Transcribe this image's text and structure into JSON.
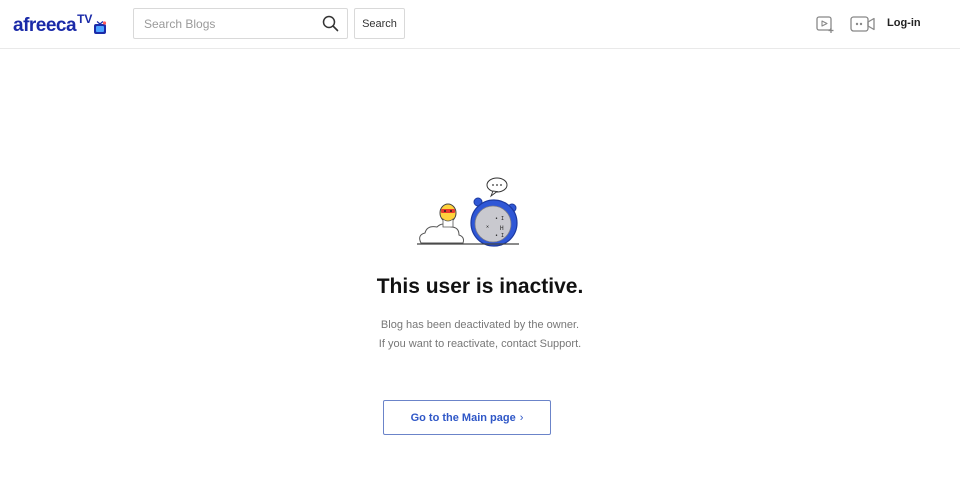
{
  "header": {
    "logo": {
      "text": "afreeca",
      "tv": "TV",
      "badge_icon": "tv-badge-icon",
      "color": "#1a2aa8"
    },
    "search": {
      "placeholder": "Search Blogs",
      "value": "",
      "button_label": "Search"
    },
    "icons": [
      "search-icon",
      "upload-icon",
      "live-broadcast-icon"
    ],
    "login_label": "Log-in"
  },
  "main": {
    "illustration_icon": "sleeping-character-illustration",
    "title": "This user is inactive.",
    "description_line1": "Blog has been deactivated by the owner.",
    "description_line2": "If you want to reactivate, contact Support.",
    "button_label": "Go to the Main page",
    "button_chevron": "›",
    "accent_color": "#2f57c7"
  }
}
